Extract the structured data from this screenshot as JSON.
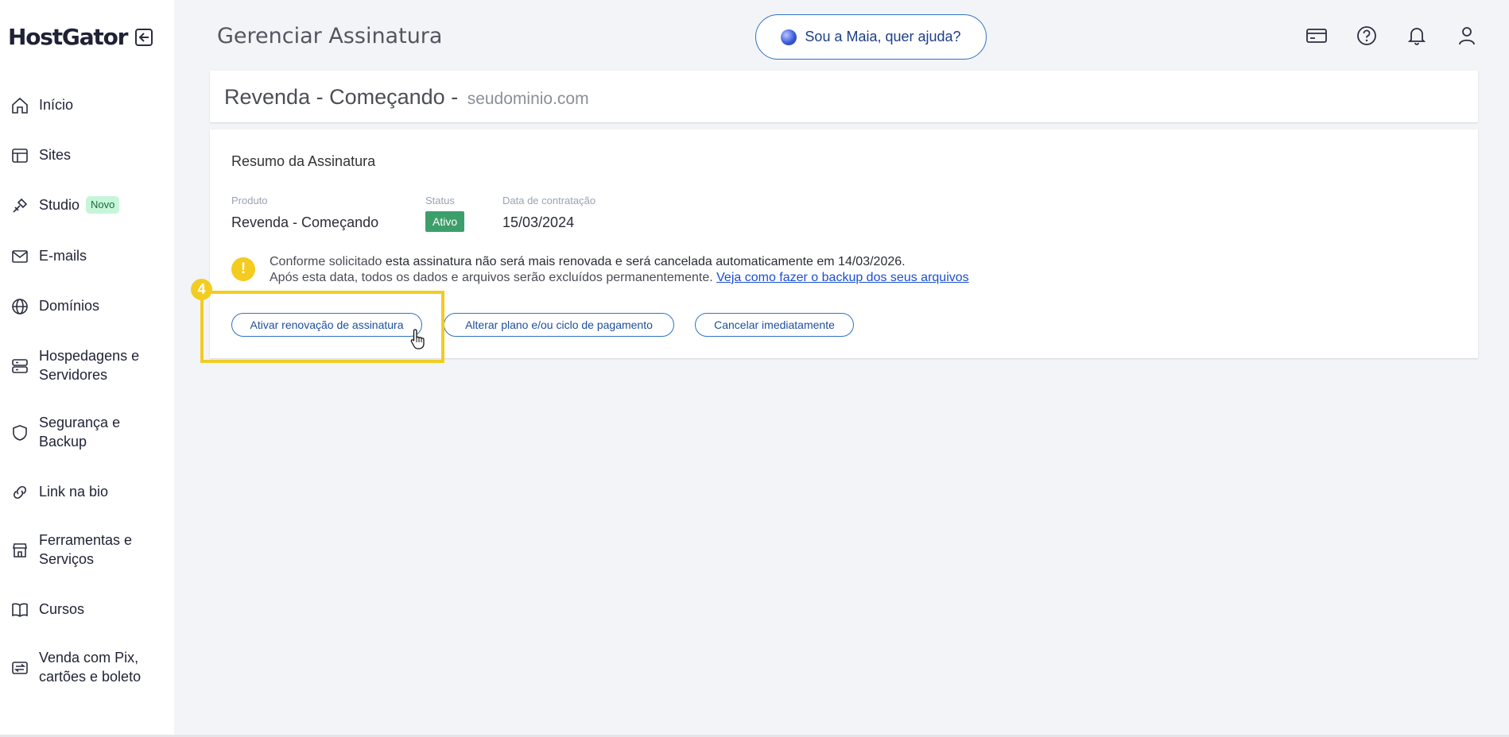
{
  "brand": {
    "logo": "HostGator"
  },
  "sidebar": {
    "items": [
      {
        "label": "Início",
        "icon": "home-icon"
      },
      {
        "label": "Sites",
        "icon": "layout-icon"
      },
      {
        "label": "Studio",
        "icon": "tools-icon",
        "badge": "Novo"
      },
      {
        "label": "E-mails",
        "icon": "mail-icon"
      },
      {
        "label": "Domínios",
        "icon": "globe-icon"
      },
      {
        "label": "Hospedagens e Servidores",
        "icon": "server-icon"
      },
      {
        "label": "Segurança e Backup",
        "icon": "shield-icon"
      },
      {
        "label": "Link na bio",
        "icon": "link-icon"
      },
      {
        "label": "Ferramentas e Serviços",
        "icon": "store-icon"
      },
      {
        "label": "Cursos",
        "icon": "book-icon"
      },
      {
        "label": "Venda com Pix, cartões e boleto",
        "icon": "transfer-icon"
      }
    ]
  },
  "header": {
    "title": "Gerenciar Assinatura",
    "maia_button": "Sou a Maia, quer ajuda?",
    "icons": [
      "card-icon",
      "help-icon",
      "bell-icon",
      "user-icon"
    ]
  },
  "plan": {
    "name": "Revenda - Começando",
    "separator": "-",
    "domain": "seudominio.com"
  },
  "summary": {
    "title": "Resumo da Assinatura",
    "product_label": "Produto",
    "product_value": "Revenda - Começando",
    "status_label": "Status",
    "status_value": "Ativo",
    "date_label": "Data de contratação",
    "date_value": "15/03/2024",
    "alert_line1_a": "Conforme solicitado ",
    "alert_line1_b": "esta assinatura não será mais renovada e será cancelada automaticamente em 14/03/2026.",
    "alert_line2": "Após esta data, todos os dados e arquivos serão excluídos permanentemente. ",
    "alert_link": "Veja como fazer o backup dos seus arquivos",
    "alert_icon_glyph": "!"
  },
  "actions": {
    "reactivate": "Ativar renovação de assinatura",
    "change_plan": "Alterar plano e/ou ciclo de pagamento",
    "cancel_now": "Cancelar imediatamente"
  },
  "annotation": {
    "step": "4"
  },
  "colors": {
    "accent": "#2f73c4",
    "status_active": "#3c9f6a",
    "highlight": "#f2cc22",
    "badge_new_bg": "#c6f5d8"
  }
}
